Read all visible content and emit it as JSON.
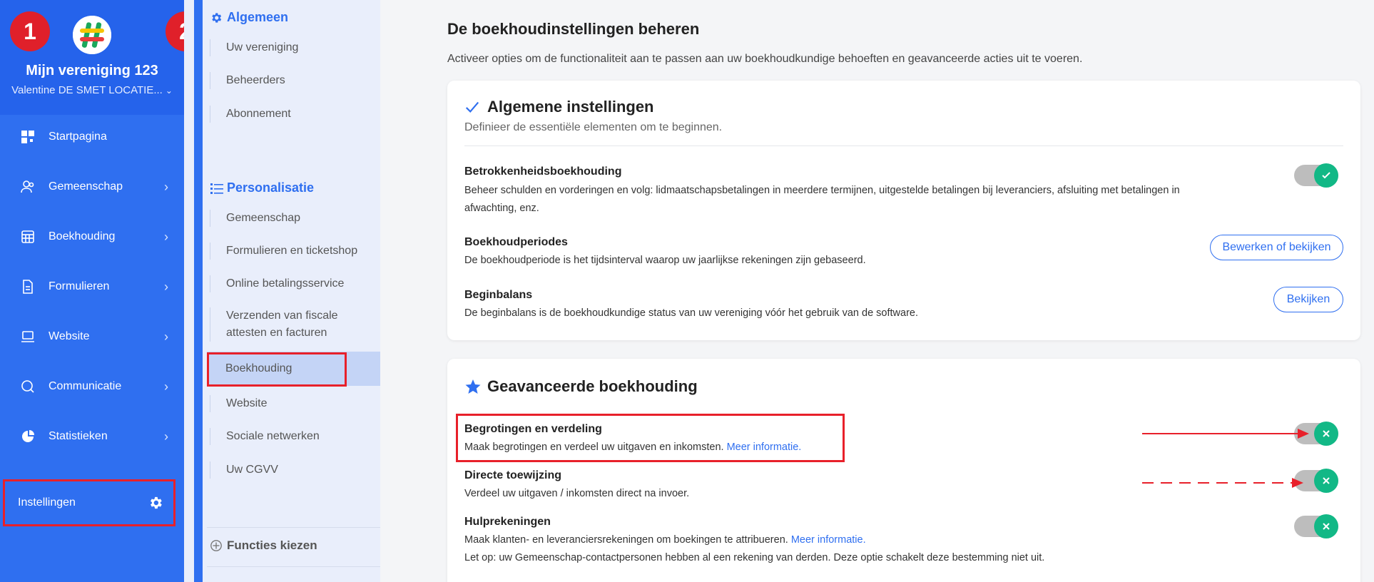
{
  "sidebar": {
    "org_name": "Mijn vereniging 123",
    "user_name": "Valentine DE SMET LOCATIE...",
    "items": [
      {
        "label": "Startpagina",
        "icon": "dashboard-icon"
      },
      {
        "label": "Gemeenschap",
        "icon": "community-icon"
      },
      {
        "label": "Boekhouding",
        "icon": "calculator-icon"
      },
      {
        "label": "Formulieren",
        "icon": "document-icon"
      },
      {
        "label": "Website",
        "icon": "laptop-icon"
      },
      {
        "label": "Communicatie",
        "icon": "chat-icon"
      },
      {
        "label": "Statistieken",
        "icon": "pie-chart-icon"
      }
    ],
    "settings_label": "Instellingen"
  },
  "badges": {
    "one": "1",
    "two": "2"
  },
  "subnav": {
    "section1_title": "Algemeen",
    "section1_items": [
      "Uw vereniging",
      "Beheerders",
      "Abonnement"
    ],
    "section2_title": "Personalisatie",
    "section2_items": [
      "Gemeenschap",
      "Formulieren en ticketshop",
      "Online betalingsservice",
      "Verzenden van fiscale attesten en facturen",
      "Boekhouding",
      "Website",
      "Sociale netwerken",
      "Uw CGVV"
    ],
    "bottom_label": "Functies kiezen"
  },
  "main": {
    "title": "De boekhoudinstellingen beheren",
    "description": "Activeer opties om de functionaliteit aan te passen aan uw boekhoudkundige behoeften en geavanceerde acties uit te voeren.",
    "card1": {
      "title": "Algemene instellingen",
      "subtitle": "Definieer de essentiële elementen om te beginnen.",
      "rows": [
        {
          "title": "Betrokkenheidsboekhouding",
          "desc": "Beheer schulden en vorderingen en volg: lidmaatschapsbetalingen in meerdere termijnen, uitgestelde betalingen bij leveranciers, afsluiting met betalingen in afwachting, enz."
        },
        {
          "title": "Boekhoudperiodes",
          "desc": "De boekhoudperiode is het tijdsinterval waarop uw jaarlijkse rekeningen zijn gebaseerd.",
          "button": "Bewerken of bekijken"
        },
        {
          "title": "Beginbalans",
          "desc": "De beginbalans is de boekhoudkundige status van uw vereniging vóór het gebruik van de software.",
          "button": "Bekijken"
        }
      ]
    },
    "card2": {
      "title": "Geavanceerde boekhouding",
      "rows": [
        {
          "title": "Begrotingen en verdeling",
          "desc": "Maak begrotingen en verdeel uw uitgaven en inkomsten.",
          "link": "Meer informatie."
        },
        {
          "title": "Directe toewijzing",
          "desc": "Verdeel uw uitgaven / inkomsten direct na invoer."
        },
        {
          "title": "Hulprekeningen",
          "desc": "Maak klanten- en leveranciersrekeningen om boekingen te attribueren.",
          "link": "Meer informatie.",
          "note": "Let op: uw Gemeenschap-contactpersonen hebben al een rekening van derden. Deze optie schakelt deze bestemming niet uit."
        }
      ]
    }
  },
  "colors": {
    "primary": "#2f6ff0",
    "toggle_on": "#12b886",
    "annotation": "#e8202a"
  }
}
